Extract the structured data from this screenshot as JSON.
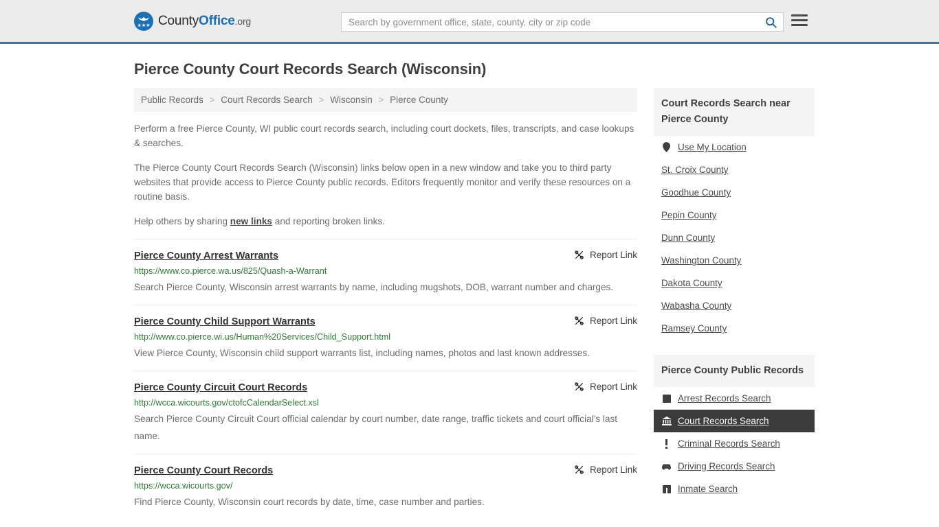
{
  "header": {
    "logo": {
      "part1": "County",
      "part2": "Office",
      "part3": ".org",
      "icon": "eagle-shield-icon"
    },
    "search": {
      "placeholder": "Search by government office, state, county, city or zip code",
      "value": "",
      "search_icon": "search-icon"
    },
    "menu_icon": "hamburger-menu-icon",
    "accent_color": "#1a6fb5",
    "border_color": "#3b72a5",
    "background_color": "#ececec"
  },
  "page": {
    "title": "Pierce County Court Records Search (Wisconsin)"
  },
  "breadcrumb": {
    "separator": ">",
    "items": [
      {
        "label": "Public Records"
      },
      {
        "label": "Court Records Search"
      },
      {
        "label": "Wisconsin"
      },
      {
        "label": "Pierce County"
      }
    ]
  },
  "intro": {
    "p1": "Perform a free Pierce County, WI public court records search, including court dockets, files, transcripts, and case lookups & searches.",
    "p2": "The Pierce County Court Records Search (Wisconsin) links below open in a new window and take you to third party websites that provide access to Pierce County public records. Editors frequently monitor and verify these resources on a routine basis.",
    "p3_before": "Help others by sharing ",
    "p3_link": "new links",
    "p3_after": " and reporting broken links."
  },
  "results": {
    "report_label": "Report Link",
    "report_icon": "broken-link-icon",
    "url_color": "#2e7d32",
    "items": [
      {
        "title": "Pierce County Arrest Warrants",
        "url": "https://www.co.pierce.wa.us/825/Quash-a-Warrant",
        "description": "Search Pierce County, Wisconsin arrest warrants by name, including mugshots, DOB, warrant number and charges."
      },
      {
        "title": "Pierce County Child Support Warrants",
        "url": "http://www.co.pierce.wi.us/Human%20Services/Child_Support.html",
        "description": "View Pierce County, Wisconsin child support warrants list, including names, photos and last known addresses."
      },
      {
        "title": "Pierce County Circuit Court Records",
        "url": "http://wcca.wicourts.gov/ctofcCalendarSelect.xsl",
        "description": "Search Pierce County Circuit Court official calendar by court number, date range, traffic tickets and court official's last name."
      },
      {
        "title": "Pierce County Court Records",
        "url": "https://wcca.wicourts.gov/",
        "description": "Find Pierce County, Wisconsin court records by date, time, case number and parties."
      }
    ]
  },
  "sidebar": {
    "near": {
      "title": "Court Records Search near Pierce County",
      "use_my_location": {
        "label": "Use My Location",
        "icon": "map-pin-icon"
      },
      "counties": [
        {
          "label": "St. Croix County"
        },
        {
          "label": "Goodhue County"
        },
        {
          "label": "Pepin County"
        },
        {
          "label": "Dunn County"
        },
        {
          "label": "Washington County"
        },
        {
          "label": "Dakota County"
        },
        {
          "label": "Wabasha County"
        },
        {
          "label": "Ramsey County"
        }
      ]
    },
    "public_records": {
      "title": "Pierce County Public Records",
      "active_background": "#3c3c3c",
      "items": [
        {
          "label": "Arrest Records Search",
          "icon": "fingerprint-icon",
          "active": false
        },
        {
          "label": "Court Records Search",
          "icon": "courthouse-icon",
          "active": true
        },
        {
          "label": "Criminal Records Search",
          "icon": "exclamation-icon",
          "active": false
        },
        {
          "label": "Driving Records Search",
          "icon": "car-icon",
          "active": false
        },
        {
          "label": "Inmate Search",
          "icon": "jail-door-icon",
          "active": false
        }
      ]
    }
  }
}
